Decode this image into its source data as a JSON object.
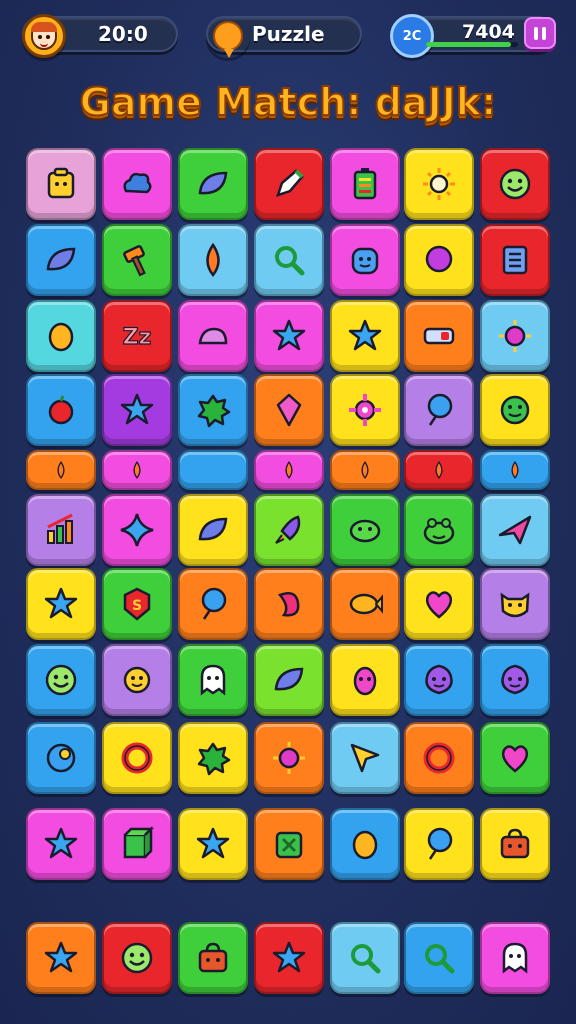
{
  "hud": {
    "timer": "20:0",
    "mode_label": "Puzzle",
    "score_badge": "2C",
    "score": "7404",
    "progress_fraction": 0.92
  },
  "title": "Game Match: daJJk:",
  "colors": {
    "pink": "#e7a3d8",
    "magenta": "#f24de0",
    "green": "#3fcf3a",
    "red": "#e8262b",
    "yellow": "#ffe11c",
    "blue": "#33a3f0",
    "sky": "#6fcbf2",
    "orange": "#ff7f1c",
    "purple": "#b57fe8",
    "violet": "#a43be0",
    "teal": "#55d7e0",
    "lime": "#7ae22f"
  },
  "grid": [
    [
      {
        "color": "pink",
        "icon": "block-face-icon"
      },
      {
        "color": "magenta",
        "icon": "cloud-icon"
      },
      {
        "color": "green",
        "icon": "leaf-icon"
      },
      {
        "color": "red",
        "icon": "pen-icon"
      },
      {
        "color": "magenta",
        "icon": "battery-icon"
      },
      {
        "color": "yellow",
        "icon": "sun-icon"
      },
      {
        "color": "red",
        "icon": "smile-face-icon"
      }
    ],
    [
      {
        "color": "blue",
        "icon": "leaf-icon"
      },
      {
        "color": "green",
        "icon": "hammer-icon"
      },
      {
        "color": "sky",
        "icon": "drop-icon"
      },
      {
        "color": "sky",
        "icon": "magnifier-icon"
      },
      {
        "color": "magenta",
        "icon": "robot-face-icon"
      },
      {
        "color": "yellow",
        "icon": "bubble-icon"
      },
      {
        "color": "red",
        "icon": "list-icon"
      }
    ],
    [
      {
        "color": "teal",
        "icon": "egg-icon"
      },
      {
        "color": "red",
        "icon": "zz-icon"
      },
      {
        "color": "magenta",
        "icon": "cap-icon"
      },
      {
        "color": "magenta",
        "icon": "star-icon"
      },
      {
        "color": "yellow",
        "icon": "star-icon"
      },
      {
        "color": "orange",
        "icon": "toggle-icon"
      },
      {
        "color": "sky",
        "icon": "gem-icon"
      }
    ],
    [
      {
        "color": "blue",
        "icon": "apple-icon"
      },
      {
        "color": "violet",
        "icon": "star-icon"
      },
      {
        "color": "blue",
        "icon": "splat-icon"
      },
      {
        "color": "orange",
        "icon": "shield-icon"
      },
      {
        "color": "yellow",
        "icon": "crosshair-icon"
      },
      {
        "color": "purple",
        "icon": "balloon-icon"
      },
      {
        "color": "yellow",
        "icon": "slime-icon"
      }
    ],
    [
      {
        "color": "orange",
        "icon": "drop-icon"
      },
      {
        "color": "magenta",
        "icon": "drop-icon"
      },
      {
        "color": "blue",
        "icon": "none"
      },
      {
        "color": "magenta",
        "icon": "drop-icon"
      },
      {
        "color": "orange",
        "icon": "drop-icon"
      },
      {
        "color": "red",
        "icon": "drop-icon"
      },
      {
        "color": "blue",
        "icon": "drop-icon"
      }
    ],
    [
      {
        "color": "purple",
        "icon": "chart-icon"
      },
      {
        "color": "magenta",
        "icon": "sparkle-icon"
      },
      {
        "color": "yellow",
        "icon": "leaf-icon"
      },
      {
        "color": "lime",
        "icon": "rocket-icon"
      },
      {
        "color": "green",
        "icon": "blob-icon"
      },
      {
        "color": "green",
        "icon": "frog-icon"
      },
      {
        "color": "sky",
        "icon": "plane-icon"
      }
    ],
    [
      {
        "color": "yellow",
        "icon": "star-icon"
      },
      {
        "color": "green",
        "icon": "badge-icon"
      },
      {
        "color": "orange",
        "icon": "balloon-icon"
      },
      {
        "color": "orange",
        "icon": "bean-icon"
      },
      {
        "color": "orange",
        "icon": "fish-icon"
      },
      {
        "color": "yellow",
        "icon": "heart-icon"
      },
      {
        "color": "purple",
        "icon": "cat-face-icon"
      }
    ],
    [
      {
        "color": "blue",
        "icon": "smile-face-icon"
      },
      {
        "color": "purple",
        "icon": "sun-face-icon"
      },
      {
        "color": "green",
        "icon": "ghost-icon"
      },
      {
        "color": "lime",
        "icon": "leaf-icon"
      },
      {
        "color": "yellow",
        "icon": "pear-face-icon"
      },
      {
        "color": "blue",
        "icon": "blob-face-icon"
      },
      {
        "color": "blue",
        "icon": "blob-face-icon"
      }
    ],
    [
      {
        "color": "blue",
        "icon": "moon-icon"
      },
      {
        "color": "yellow",
        "icon": "ring-icon"
      },
      {
        "color": "yellow",
        "icon": "splat-icon"
      },
      {
        "color": "orange",
        "icon": "gem-icon"
      },
      {
        "color": "sky",
        "icon": "cursor-icon"
      },
      {
        "color": "orange",
        "icon": "ring-icon"
      },
      {
        "color": "green",
        "icon": "heart-icon"
      }
    ],
    [
      {
        "color": "magenta",
        "icon": "star-icon"
      },
      {
        "color": "magenta",
        "icon": "box-icon"
      },
      {
        "color": "yellow",
        "icon": "star-icon"
      },
      {
        "color": "orange",
        "icon": "cube-icon"
      },
      {
        "color": "blue",
        "icon": "egg-icon"
      },
      {
        "color": "yellow",
        "icon": "balloon-icon"
      },
      {
        "color": "yellow",
        "icon": "bag-icon"
      }
    ]
  ],
  "tray": [
    {
      "color": "orange",
      "icon": "star-icon"
    },
    {
      "color": "red",
      "icon": "smile-face-icon"
    },
    {
      "color": "green",
      "icon": "bag-icon"
    },
    {
      "color": "red",
      "icon": "star-icon"
    },
    {
      "color": "sky",
      "icon": "magnifier-icon"
    },
    {
      "color": "blue",
      "icon": "magnifier-icon"
    },
    {
      "color": "magenta",
      "icon": "ghost-icon"
    }
  ]
}
